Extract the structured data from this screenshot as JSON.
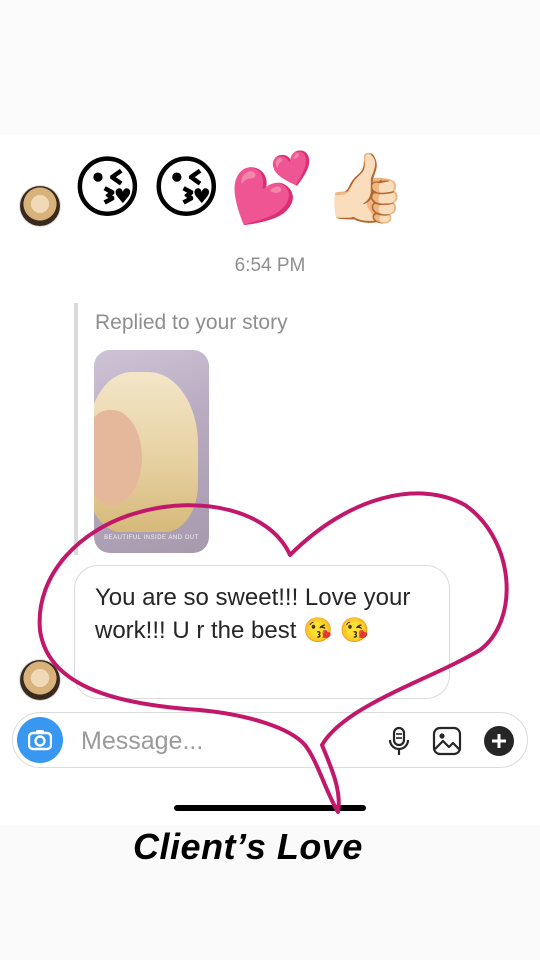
{
  "thread": {
    "reaction_emojis": [
      "😘",
      "😘",
      "💕",
      "👍🏻"
    ],
    "timestamp": "6:54 PM",
    "story_reply": {
      "label": "Replied to your story",
      "story_caption": "BEAUTIFUL INSIDE AND OUT"
    },
    "message_text": "You are so sweet!!! Love your work!!! U r the best 😘 😘"
  },
  "composer": {
    "placeholder": "Message...",
    "icons": [
      "camera-icon",
      "microphone-icon",
      "gallery-icon",
      "plus-icon"
    ]
  },
  "overlay": {
    "caption": "Client’s Love",
    "heart_color": "#c2186b"
  },
  "colors": {
    "accent_blue": "#3897f0",
    "muted_text": "#8e8e8e",
    "border": "#dbdbdb"
  }
}
